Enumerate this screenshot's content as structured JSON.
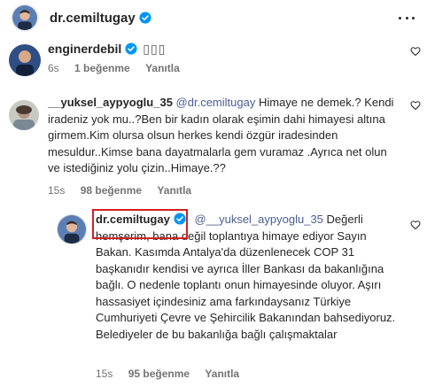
{
  "header": {
    "username": "dr.cemiltugay",
    "more_icon": "more-horizontal-icon"
  },
  "comment1": {
    "username": "enginerdebil",
    "suffix": "▯▯▯",
    "time": "6s",
    "likes": "1 beğenme",
    "reply": "Yanıtla"
  },
  "comment2": {
    "username": "__yuksel_aypyoglu_35",
    "mention": "@dr.cemiltugay",
    "text": "Himaye ne demek.? Kendi iradeniz yok mu..?Ben bir kadın olarak eşimin dahi himayesi altına girmem.Kim olursa olsun herkes kendi özgür iradesinden mesuldur..Kimse bana dayatmalarla gem vuramaz .Ayrıca net olun ve istediğiniz yolu çizin..Himaye.??",
    "time": "15s",
    "likes": "98 beğenme",
    "reply": "Yanıtla"
  },
  "reply": {
    "username": "dr.cemiltugay",
    "mention": "@__yuksel_aypyoglu_35",
    "text": "Değerli hemşerim, bana değil toplantıya himaye ediyor Sayın Bakan. Kasımda Antalya'da düzenlenecek COP 31 başkanıdır kendisi ve ayrıca İller Bankası da bakanlığına bağlı. O nedenle toplantı onun himayesinde oluyor. Aşırı hassasiyet içindesiniz ama farkındaysanız Türkiye Cumhuriyeti Çevre ve Şehircilik Bakanından bahsediyoruz. Belediyeler de bu bakanlığa bağlı çalışmaktalar",
    "time": "15s",
    "likes": "95 beğenme",
    "reply_label": "Yanıtla"
  },
  "colors": {
    "mention": "#4a5d96",
    "meta": "#737373",
    "verified": "#0095f6",
    "highlight": "#d32020"
  }
}
